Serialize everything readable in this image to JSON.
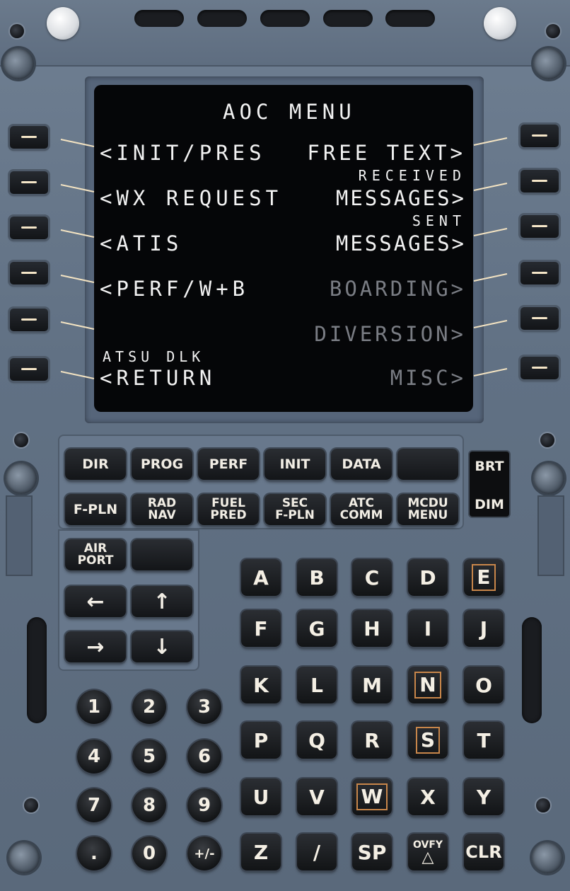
{
  "screen": {
    "title": "AOC MENU",
    "left": [
      {
        "label": "<INIT/PRES",
        "small": "",
        "active": true
      },
      {
        "label": "<WX REQUEST",
        "small": "",
        "active": true
      },
      {
        "label": "<ATIS",
        "small": "",
        "active": true
      },
      {
        "label": "<PERF/W+B",
        "small": "",
        "active": true
      },
      {
        "label": "",
        "small": "",
        "active": false
      },
      {
        "label": "<RETURN",
        "small": "ATSU DLK",
        "active": true
      }
    ],
    "right": [
      {
        "label": "FREE TEXT>",
        "small": "",
        "active": true
      },
      {
        "label": "MESSAGES>",
        "small": "RECEIVED",
        "active": true
      },
      {
        "label": "MESSAGES>",
        "small": "SENT",
        "active": true
      },
      {
        "label": "BOARDING>",
        "small": "",
        "active": false
      },
      {
        "label": "DIVERSION>",
        "small": "",
        "active": false
      },
      {
        "label": "MISC>",
        "small": "",
        "active": false
      }
    ],
    "text_color": "#f2f2f2",
    "inactive_color": "#7a7d84"
  },
  "function_keys": {
    "row1": [
      "DIR",
      "PROG",
      "PERF",
      "INIT",
      "DATA",
      ""
    ],
    "row2": [
      "F-PLN",
      "RAD\nNAV",
      "FUEL\nPRED",
      "SEC\nF-PLN",
      "ATC\nCOMM",
      "MCDU\nMENU"
    ],
    "airport": "AIR\nPORT",
    "blank": ""
  },
  "arrows": {
    "left": "←",
    "up": "↑",
    "right": "→",
    "down": "↓"
  },
  "brightness": {
    "brt": "BRT",
    "dim": "DIM"
  },
  "alpha_keys": [
    "A",
    "B",
    "C",
    "D",
    "E",
    "F",
    "G",
    "H",
    "I",
    "J",
    "K",
    "L",
    "M",
    "N",
    "O",
    "P",
    "Q",
    "R",
    "S",
    "T",
    "U",
    "V",
    "W",
    "X",
    "Y",
    "Z",
    "/",
    "SP",
    "OVFY",
    "CLR"
  ],
  "marked_keys": [
    "E",
    "N",
    "S",
    "W"
  ],
  "numeric_keys": [
    "1",
    "2",
    "3",
    "4",
    "5",
    "6",
    "7",
    "8",
    "9",
    ".",
    "0",
    "+/-"
  ],
  "colors": {
    "panel": "#617184",
    "key": "#131518",
    "key_text": "#f1ede4",
    "lsk_line": "#f3e3c2",
    "marker": "#c8864a"
  }
}
